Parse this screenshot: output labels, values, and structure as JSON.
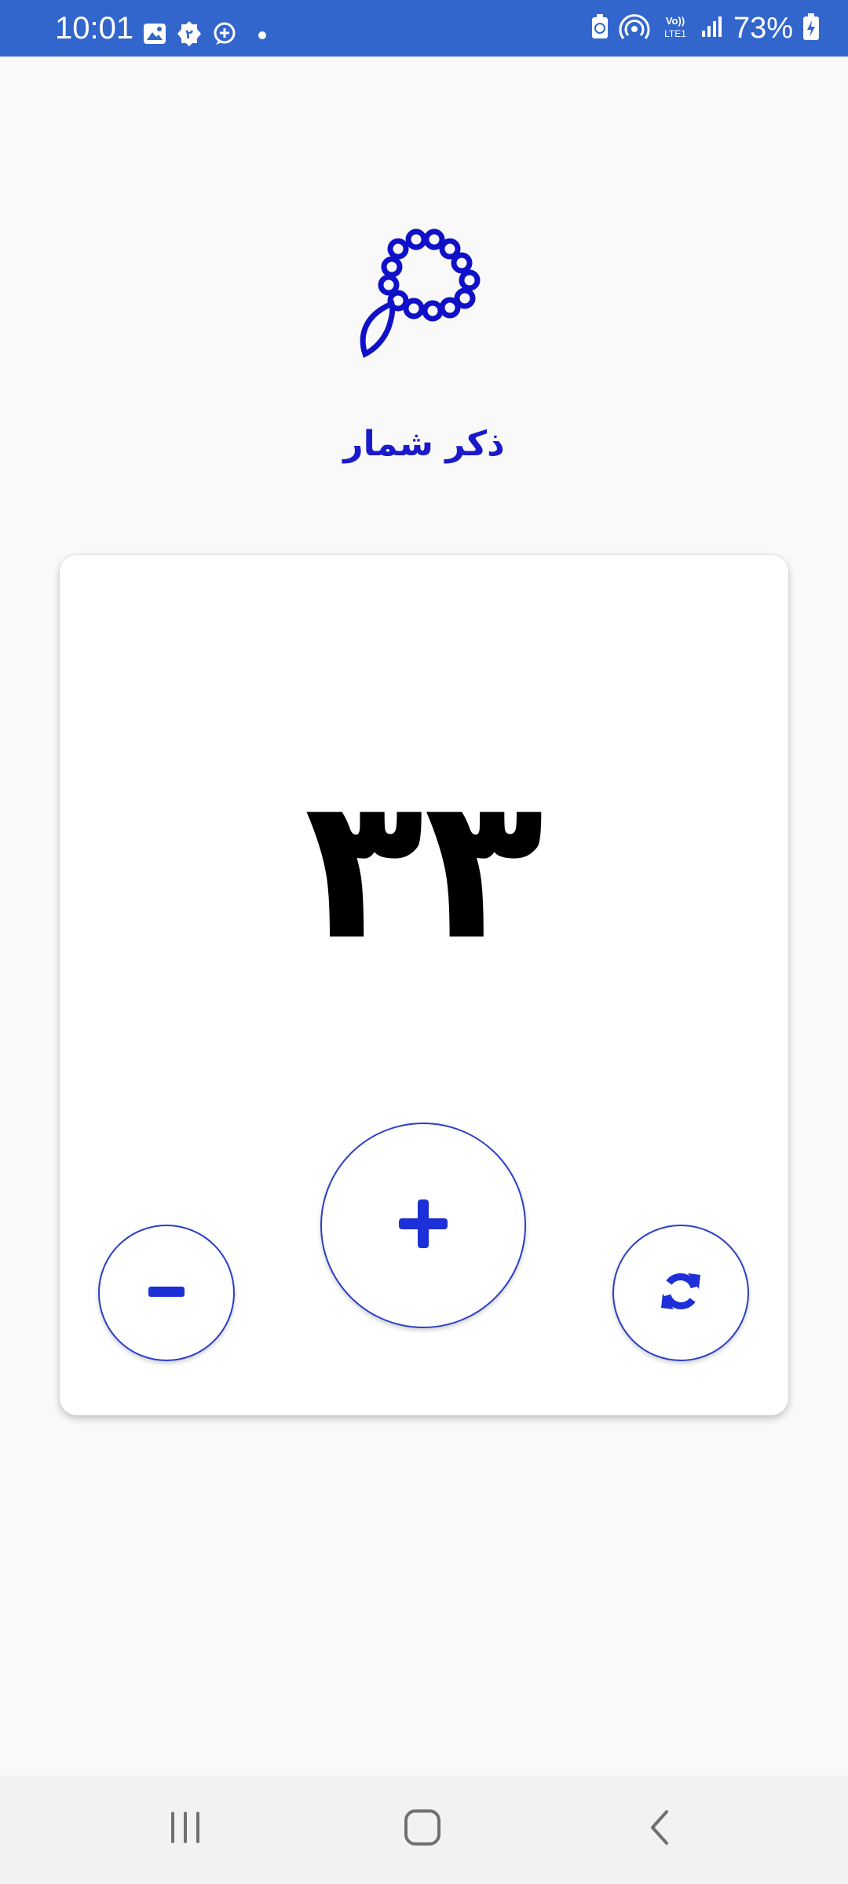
{
  "status_bar": {
    "time": "10:01",
    "battery_percent": "73%",
    "left_icons": [
      "gallery-icon",
      "notification-badge-icon",
      "add-chat-icon",
      "dot-icon"
    ],
    "right_icons": [
      "battery-saver-icon",
      "hotspot-icon",
      "volte-icon",
      "signal-icon",
      "battery-charging-icon"
    ],
    "color": "#3366cc"
  },
  "header": {
    "logo_icon": "prayer-beads-icon",
    "title": "ذکر شمار",
    "title_color": "#1a1acc"
  },
  "counter": {
    "value": "۳۳",
    "plus_icon": "plus-icon",
    "minus_icon": "minus-icon",
    "reset_icon": "refresh-icon",
    "accent_color": "#2a3ec8"
  },
  "nav_bar": {
    "buttons": [
      "recents-icon",
      "home-icon",
      "back-icon"
    ]
  }
}
